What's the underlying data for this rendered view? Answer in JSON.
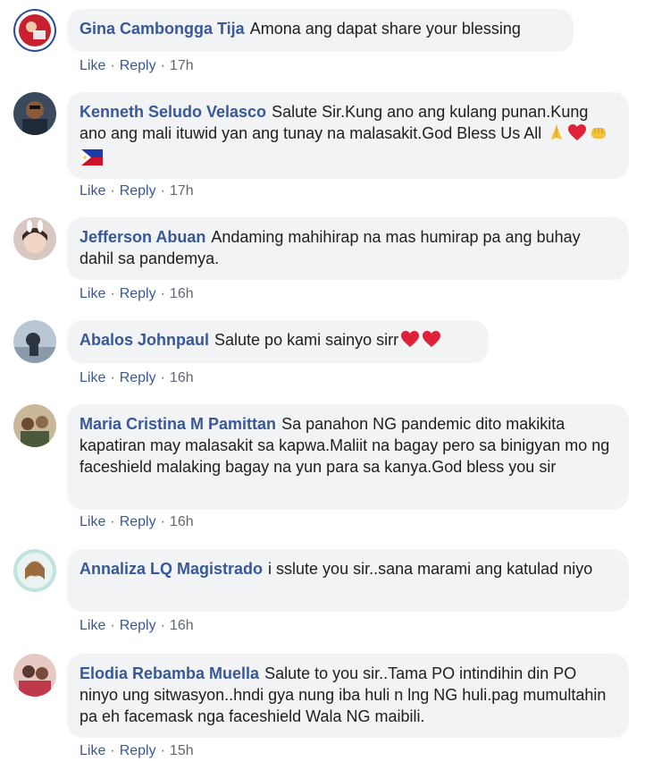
{
  "actions": {
    "like": "Like",
    "reply": "Reply",
    "separator": "·"
  },
  "comments": [
    {
      "author": "Gina Cambongga Tija",
      "text": "Amona ang dapat share your blessing",
      "time": "17h",
      "emoji": []
    },
    {
      "author": "Kenneth Seludo Velasco",
      "text": "Salute Sir.Kung ano ang kulang punan.Kung ano ang mali ituwid yan ang tunay na malasakit.God Bless Us All",
      "time": "17h",
      "emoji": [
        "folded-hands-emoji",
        "red-heart-emoji",
        "raised-fist-emoji",
        "philippine-flag-emoji"
      ]
    },
    {
      "author": "Jefferson Abuan",
      "text": "Andaming mahihirap na mas humirap pa ang buhay dahil sa pandemya.",
      "time": "16h",
      "emoji": []
    },
    {
      "author": "Abalos Johnpaul",
      "text": "Salute po kami sainyo sirr",
      "time": "16h",
      "emoji": [
        "red-heart-emoji",
        "red-heart-emoji"
      ]
    },
    {
      "author": "Maria Cristina M Pamittan",
      "text": "Sa panahon NG pandemic dito makikita kapatiran may malasakit sa kapwa.Maliit na bagay pero sa binigyan mo ng faceshield malaking bagay na yun para sa kanya.God bless you sir",
      "time": "16h",
      "emoji": []
    },
    {
      "author": "Annaliza LQ Magistrado",
      "text": "i sslute you sir..sana marami ang katulad niyo",
      "time": "16h",
      "emoji": []
    },
    {
      "author": "Elodia Rebamba Muella",
      "text": "Salute to you sir..Tama PO intindihin din PO ninyo ung sitwasyon..hndi gya nung iba huli n lng NG huli.pag mumultahin pa eh facemask nga faceshield Wala NG maibili.",
      "time": "15h",
      "emoji": []
    }
  ]
}
